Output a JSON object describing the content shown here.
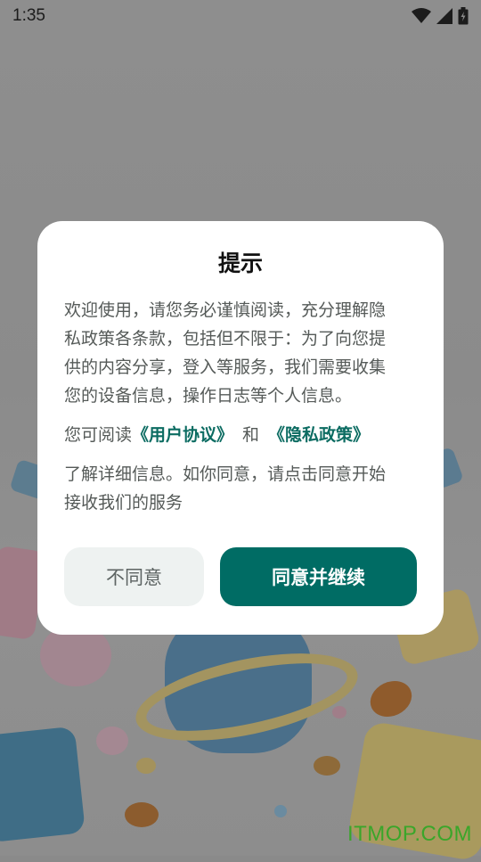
{
  "status_bar": {
    "time": "1:35",
    "icons": [
      "wifi-icon",
      "signal-icon",
      "battery-icon"
    ]
  },
  "dialog": {
    "title": "提示",
    "paragraph1_lines": [
      "欢迎使用，请您务必谨慎阅读，充分理解隐",
      "私政策各条款，包括但不限于：为了向您提",
      "供的内容分享，登入等服务，我们需要收集",
      "您的设备信息，操作日志等个人信息。"
    ],
    "policy_prefix": "您可阅读",
    "user_agreement_link": "《用户协议》",
    "and_text": "和",
    "privacy_policy_link": "《隐私政策》",
    "paragraph3_lines": [
      "了解详细信息。如你同意，请点击同意开始",
      "接收我们的服务"
    ],
    "disagree_label": "不同意",
    "agree_label": "同意并继续"
  },
  "watermark": "ITMOP.COM",
  "colors": {
    "accent": "#006c64",
    "link": "#0c6c62",
    "overlay": "#8b8b8b",
    "watermark": "#3aa62a"
  }
}
